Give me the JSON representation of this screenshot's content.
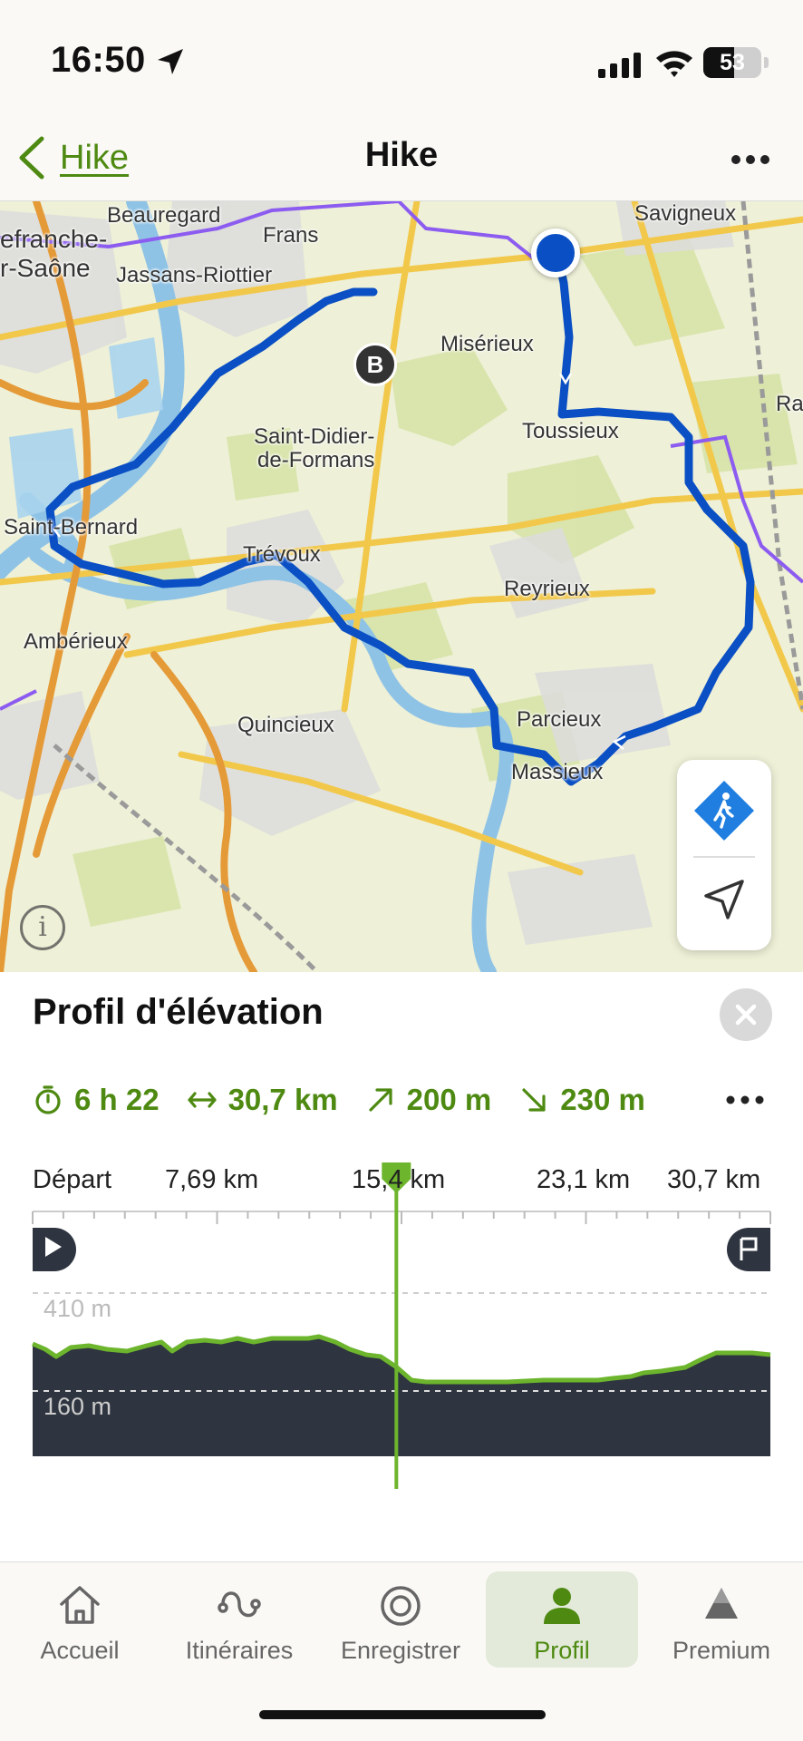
{
  "status_bar": {
    "time": "16:50",
    "battery_level": "53",
    "battery_fraction": 0.53
  },
  "nav": {
    "back_label": "Hike",
    "title": "Hike"
  },
  "map": {
    "places": [
      "Beauregard",
      "Savigneux",
      "efranche-",
      "r-Saône",
      "Frans",
      "Jassans-Riottier",
      "Misérieux",
      "Ra",
      "Toussieux",
      "Saint-Didier-",
      "de-Formans",
      "Saint-Bernard",
      "Trévoux",
      "Reyrieux",
      "Ambérieux",
      "Quincieux",
      "Parcieux",
      "Massieux"
    ],
    "marker_label": "B",
    "info_glyph": "i",
    "route_color": "#0a4fc4"
  },
  "elevation": {
    "heading": "Profil d'élévation",
    "stats": {
      "duration": "6 h 22",
      "distance": "30,7 km",
      "ascent": "200 m",
      "descent": "230 m"
    },
    "distance_ticks": [
      "Départ",
      "7,69 km",
      "15,4 km",
      "23,1 km",
      "30,7 km"
    ],
    "elevation_labels": [
      "410 m",
      "160 m"
    ],
    "cursor_km": 15.4,
    "accent_color": "#6cb52d"
  },
  "tabs": [
    {
      "label": "Accueil",
      "icon": "home-icon",
      "active": false
    },
    {
      "label": "Itinéraires",
      "icon": "route-icon",
      "active": false
    },
    {
      "label": "Enregistrer",
      "icon": "record-icon",
      "active": false
    },
    {
      "label": "Profil",
      "icon": "profile-icon",
      "active": true
    },
    {
      "label": "Premium",
      "icon": "premium-icon",
      "active": false
    }
  ]
}
